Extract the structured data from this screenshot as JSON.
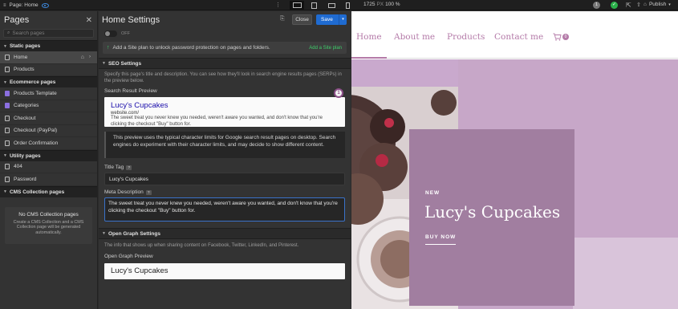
{
  "topbar": {
    "page_label": "Page: Home",
    "size_value": "1725",
    "size_unit": "PX",
    "zoom": "100 %",
    "avatar_initial": "1",
    "publish_label": "Publish"
  },
  "pages_panel": {
    "title": "Pages",
    "search_placeholder": "Search pages",
    "sections": [
      {
        "title": "Static pages",
        "items": [
          "Home",
          "Products"
        ]
      },
      {
        "title": "Ecommerce pages",
        "items": [
          "Products Template",
          "Categories",
          "Checkout",
          "Checkout (PayPal)",
          "Order Confirmation"
        ]
      },
      {
        "title": "Utility pages",
        "items": [
          "404",
          "Password"
        ]
      },
      {
        "title": "CMS Collection pages",
        "items": []
      }
    ],
    "cms_empty_title": "No CMS Collection pages",
    "cms_empty_text": "Create a CMS Collection and a CMS Collection page will be generated automatically."
  },
  "settings": {
    "title": "Home Settings",
    "close_label": "Close",
    "save_label": "Save",
    "toggle_label": "OFF",
    "upsell_text": "Add a Site plan to unlock password protection on pages and folders.",
    "upsell_link": "Add a Site plan",
    "seo_title": "SEO Settings",
    "seo_desc": "Specify this page's title and description. You can see how they'll look in search engine results pages (SERPs) in the preview below.",
    "search_preview_label": "Search Result Preview",
    "preview_title": "Lucy's Cupcakes",
    "preview_url": "website.com/",
    "preview_desc": "The sweet treat you never knew you needed, weren't aware you wanted, and don't know that you're clicking the checkout \"Buy\" button for.",
    "preview_note": "This preview uses the typical character limits for Google search result pages on desktop. Search engines do experiment with their character limits, and may decide to show different content.",
    "title_tag_label": "Title Tag",
    "title_tag_value": "Lucy's Cupcakes",
    "meta_desc_label": "Meta Description",
    "meta_desc_value": "The sweet treat you never knew you needed, weren't aware you wanted, and don't know that you're clicking the checkout \"Buy\" button for.",
    "og_title": "Open Graph Settings",
    "og_desc": "The info that shows up when sharing content on Facebook, Twitter, LinkedIn, and Pinterest.",
    "og_preview_label": "Open Graph Preview",
    "og_preview_title": "Lucy's Cupcakes",
    "help_mark": "?",
    "step_badge": "1"
  },
  "site": {
    "nav": [
      "Home",
      "About me",
      "Products",
      "Contact me"
    ],
    "cart_count": "0",
    "hero_kicker": "NEW",
    "hero_title": "Lucy's Cupcakes",
    "hero_cta": "BUY NOW",
    "colors": {
      "accent": "#b47aa8",
      "card": "#a17ea0",
      "bg": "#c9a9cd"
    }
  }
}
